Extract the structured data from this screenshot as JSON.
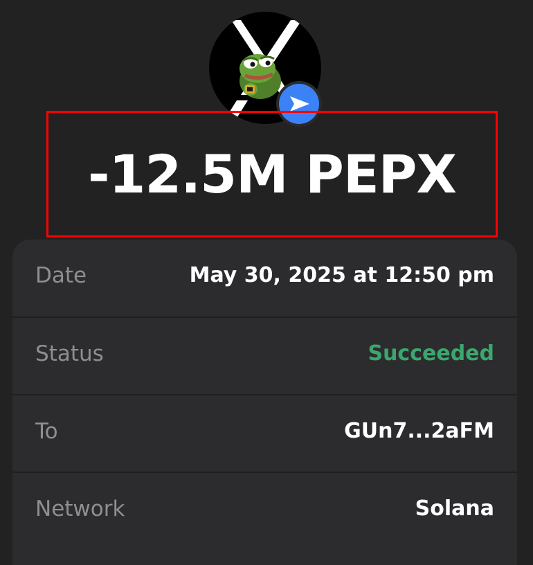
{
  "token": {
    "avatar_icon": "pepe-x-token-icon",
    "action_icon": "send-arrow-icon",
    "badge_color": "#3b82f6"
  },
  "amount": {
    "text": "-12.5M PEPX"
  },
  "details": [
    {
      "label": "Date",
      "value": "May 30, 2025 at 12:50 pm"
    },
    {
      "label": "Status",
      "value": "Succeeded",
      "value_color": "#3aa76d"
    },
    {
      "label": "To",
      "value": "GUn7...2aFM"
    },
    {
      "label": "Network",
      "value": "Solana"
    }
  ],
  "colors": {
    "background": "#222222",
    "card": "#2c2c2e",
    "label": "#8e8e93",
    "highlight_border": "#ff0000"
  }
}
